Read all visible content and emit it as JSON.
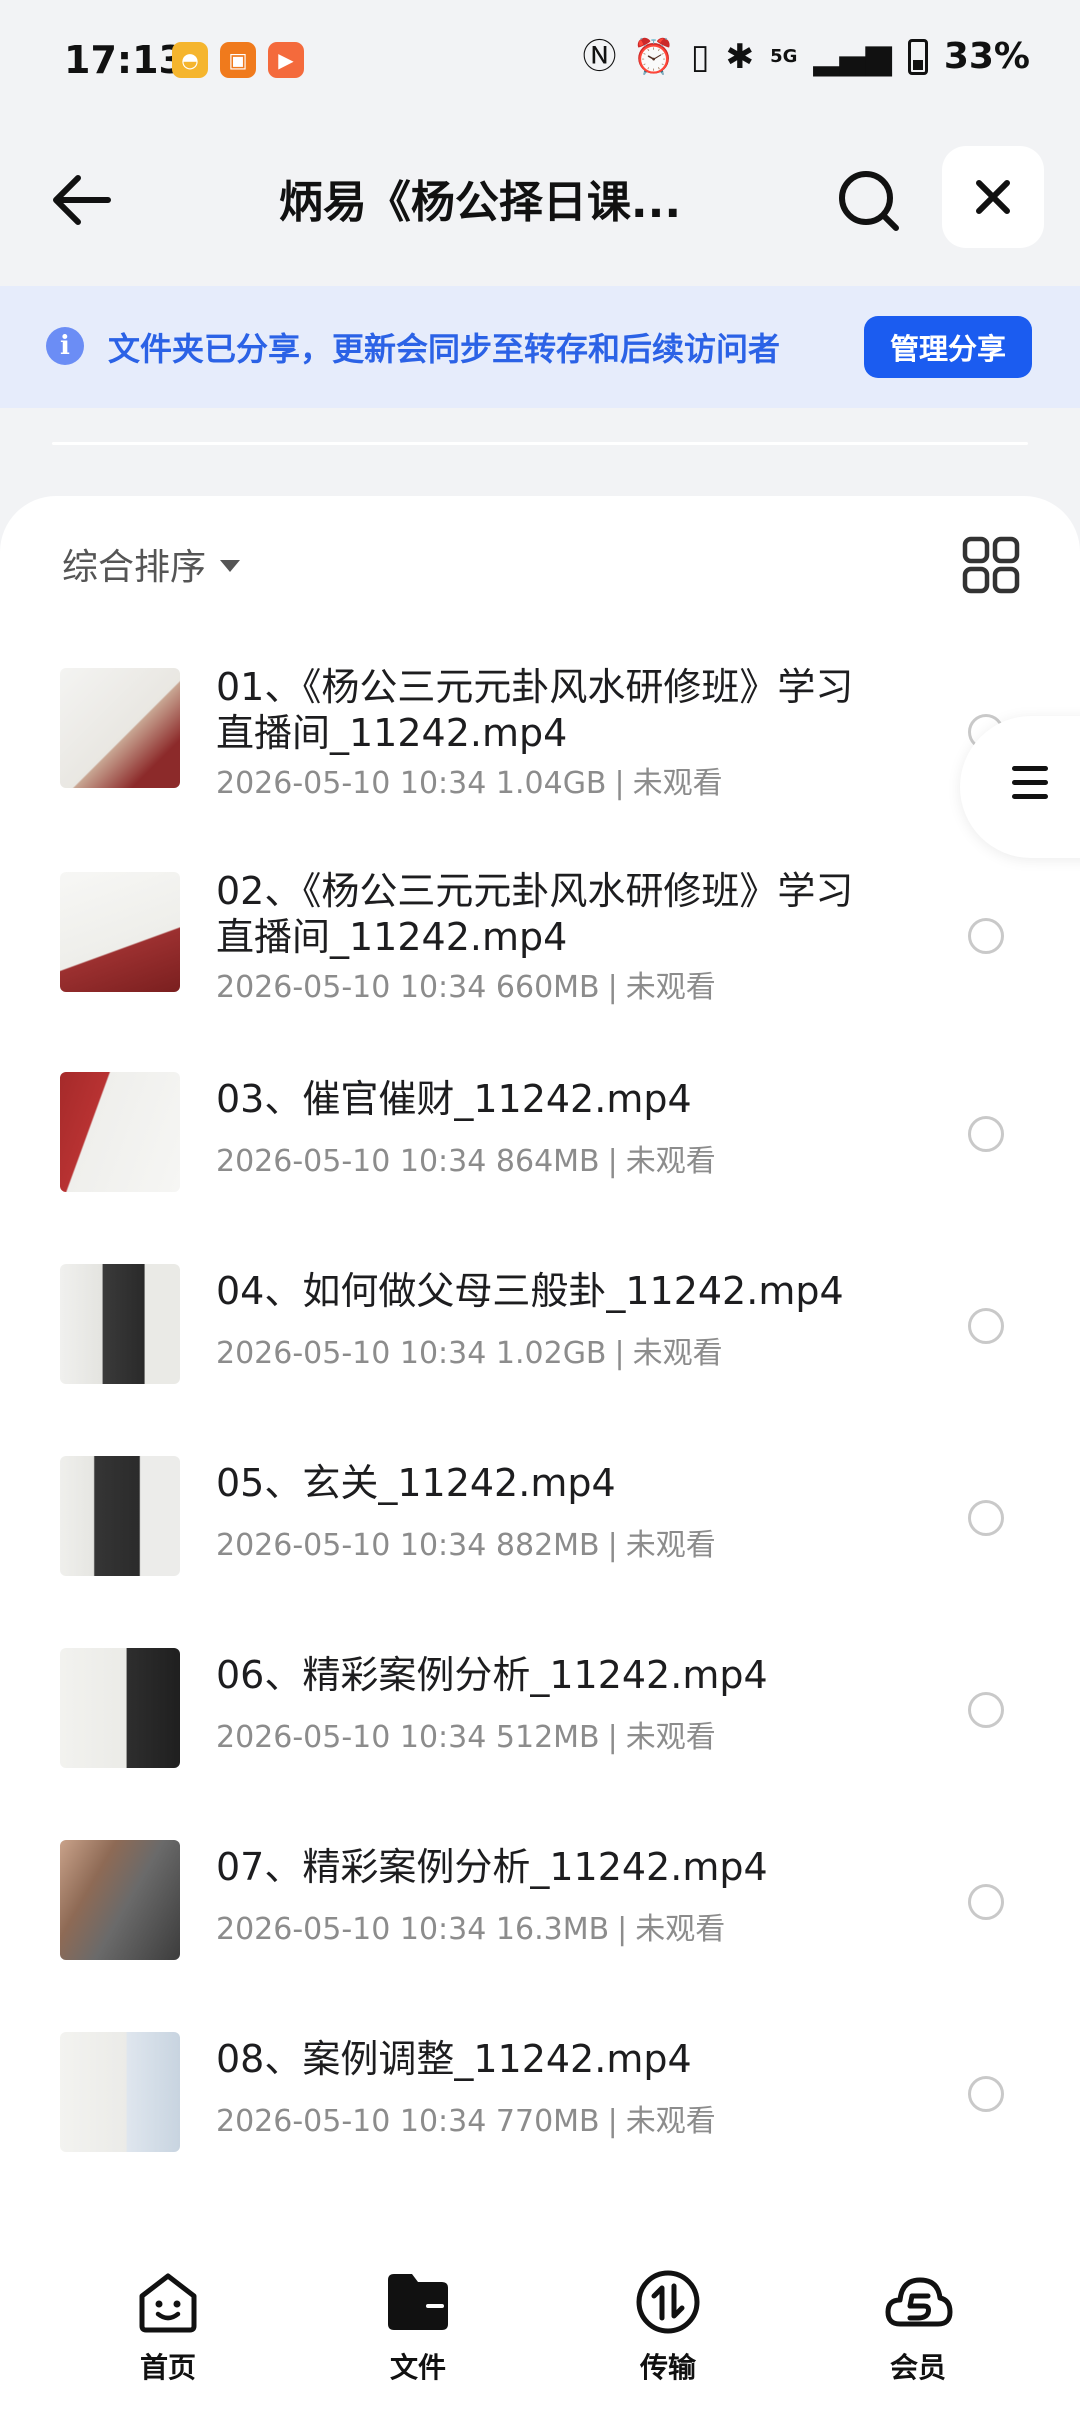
{
  "status_bar": {
    "time": "17:13",
    "network": "5G",
    "battery": "33%"
  },
  "header": {
    "title": "炳易《杨公择日课..."
  },
  "share_banner": {
    "message": "文件夹已分享，更新会同步至转存和后续访问者",
    "button": "管理分享"
  },
  "sort": {
    "label": "综合排序"
  },
  "files": [
    {
      "name": "01、《杨公三元元卦风水研修班》学习直播间_11242.mp4",
      "date": "2026-05-10 10:34",
      "size": "1.04GB",
      "status": "未观看"
    },
    {
      "name": "02、《杨公三元元卦风水研修班》学习直播间_11242.mp4",
      "date": "2026-05-10 10:34",
      "size": "660MB",
      "status": "未观看"
    },
    {
      "name": "03、催官催财_11242.mp4",
      "date": "2026-05-10 10:34",
      "size": "864MB",
      "status": "未观看"
    },
    {
      "name": "04、如何做父母三般卦_11242.mp4",
      "date": "2026-05-10 10:34",
      "size": "1.02GB",
      "status": "未观看"
    },
    {
      "name": "05、玄关_11242.mp4",
      "date": "2026-05-10 10:34",
      "size": "882MB",
      "status": "未观看"
    },
    {
      "name": "06、精彩案例分析_11242.mp4",
      "date": "2026-05-10 10:34",
      "size": "512MB",
      "status": "未观看"
    },
    {
      "name": "07、精彩案例分析_11242.mp4",
      "date": "2026-05-10 10:34",
      "size": "16.3MB",
      "status": "未观看"
    },
    {
      "name": "08、案例调整_11242.mp4",
      "date": "2026-05-10 10:34",
      "size": "770MB",
      "status": "未观看"
    }
  ],
  "bottom_nav": [
    {
      "label": "首页"
    },
    {
      "label": "文件"
    },
    {
      "label": "传输"
    },
    {
      "label": "会员"
    }
  ],
  "colors": {
    "accent": "#1b5cf0",
    "banner_bg": "#e6ecfb",
    "banner_text": "#2b62e6",
    "meta_text": "#8c8c8c"
  }
}
